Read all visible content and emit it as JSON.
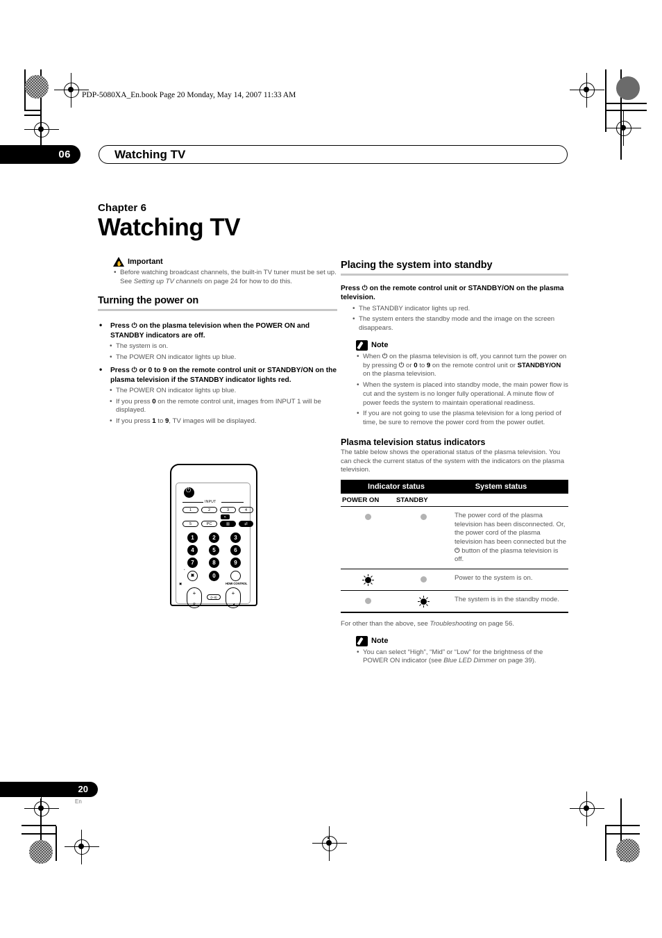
{
  "print_header": "PDP-5080XA_En.book  Page 20  Monday, May 14, 2007  11:33 AM",
  "chapter_band": {
    "number": "06",
    "title": "Watching TV"
  },
  "left": {
    "chapter_label": "Chapter 6",
    "chapter_title": "Watching TV",
    "important": {
      "label": "Important",
      "items": [
        "Before watching broadcast channels, the built-in TV tuner must be set up. See Setting up TV channels on page 24 for how to do this."
      ],
      "italic_ref": "Setting up TV channels",
      "page_ref": "24"
    },
    "section_power_on": {
      "heading": "Turning the power on",
      "steps": [
        {
          "text_before": "Press",
          "icon": "power-icon",
          "text_after": "on the plasma television when the POWER ON and STANDBY indicators are off.",
          "subitems": [
            "The system is on.",
            "The POWER ON indicator lights up blue."
          ]
        },
        {
          "text_before": "Press",
          "icon": "power-icon",
          "text_after": "or 0 to 9 on the remote control unit or STANDBY/ON on the plasma television if the STANDBY indicator lights red.",
          "subitems": [
            "The POWER ON indicator lights up blue.",
            "If you press 0 on the remote control unit, images from INPUT 1 will be displayed.",
            "If you press 1 to 9, TV images will be displayed."
          ]
        }
      ]
    },
    "remote": {
      "input_label": "INPUT",
      "input_buttons_row1": [
        "1",
        "2",
        "3",
        "4"
      ],
      "input_buttons_row2": [
        "5",
        "PC",
        "▥",
        "⇄"
      ],
      "number_buttons": [
        "1",
        "2",
        "3",
        "4",
        "5",
        "6",
        "7",
        "8",
        "9",
        "0"
      ],
      "hdmi_control_label": "HDMI CONTROL",
      "channel_label": "P",
      "volume_label": "◢"
    }
  },
  "right": {
    "section_standby": {
      "heading": "Placing the system into standby",
      "instruction_before": "Press",
      "instruction_icon": "power-icon",
      "instruction_after": "on the remote control unit or STANDBY/ON on the plasma television.",
      "subitems": [
        "The STANDBY indicator lights up red.",
        "The system enters the standby mode and the image on the screen disappears."
      ],
      "note": {
        "label": "Note",
        "items": [
          "When ⏻ on the plasma television is off, you cannot turn the power on by pressing ⏻ or 0 to 9 on the remote control unit or STANDBY/ON on the plasma television.",
          "When the system is placed into standby mode, the main power flow is cut and the system is no longer fully operational. A minute flow of power feeds the system to maintain operational readiness.",
          "If you are not going to use the plasma television for a long period of time, be sure to remove the power cord from the power outlet."
        ]
      }
    },
    "status_section": {
      "heading": "Plasma television status indicators",
      "intro": "The table below shows the operational status of the plasma television. You can check the current status of the system with the indicators on the plasma television.",
      "table": {
        "header_col1": "Indicator status",
        "header_col2": "System status",
        "subheader_col1": "POWER ON",
        "subheader_col2": "STANDBY",
        "rows": [
          {
            "power_on": "off",
            "standby": "off",
            "description": "The power cord of the plasma television has been disconnected. Or, the power cord of the plasma television has been connected but the ⏻ button of the plasma television is off."
          },
          {
            "power_on": "on",
            "standby": "off",
            "description": "Power to the system is on."
          },
          {
            "power_on": "off",
            "standby": "on",
            "description": "The system is in the standby mode."
          }
        ]
      },
      "footnote_before": "For other than the above, see ",
      "footnote_italic": "Troubleshooting",
      "footnote_after": " on page 56.",
      "note": {
        "label": "Note",
        "item_before": "You can select “High”, “Mid” or “Low” for the brightness of the POWER ON indicator (see ",
        "item_italic": "Blue LED Dimmer",
        "item_after": " on page 39)."
      }
    }
  },
  "footer": {
    "page_number": "20",
    "language": "En"
  },
  "colors": {
    "accent_black": "#000000",
    "rule_gray": "#c6c6c6",
    "body_gray": "#555555",
    "led_off": "#b3b3b3"
  }
}
